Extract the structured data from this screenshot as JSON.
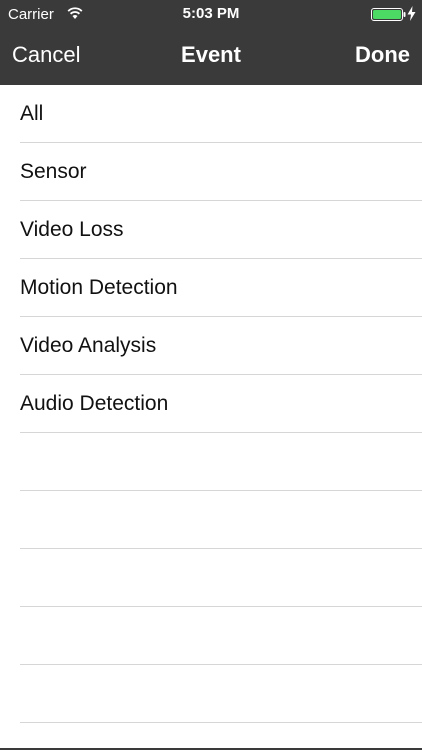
{
  "status_bar": {
    "carrier": "Carrier",
    "time": "5:03 PM",
    "icons": [
      "wifi-icon",
      "battery-icon",
      "charging-bolt-icon"
    ],
    "battery_color": "#4cd964"
  },
  "nav": {
    "cancel_label": "Cancel",
    "title": "Event",
    "done_label": "Done",
    "background": "#3a3a3a"
  },
  "events": [
    {
      "label": "All"
    },
    {
      "label": "Sensor"
    },
    {
      "label": "Video Loss"
    },
    {
      "label": "Motion Detection"
    },
    {
      "label": "Video Analysis"
    },
    {
      "label": "Audio Detection"
    }
  ]
}
